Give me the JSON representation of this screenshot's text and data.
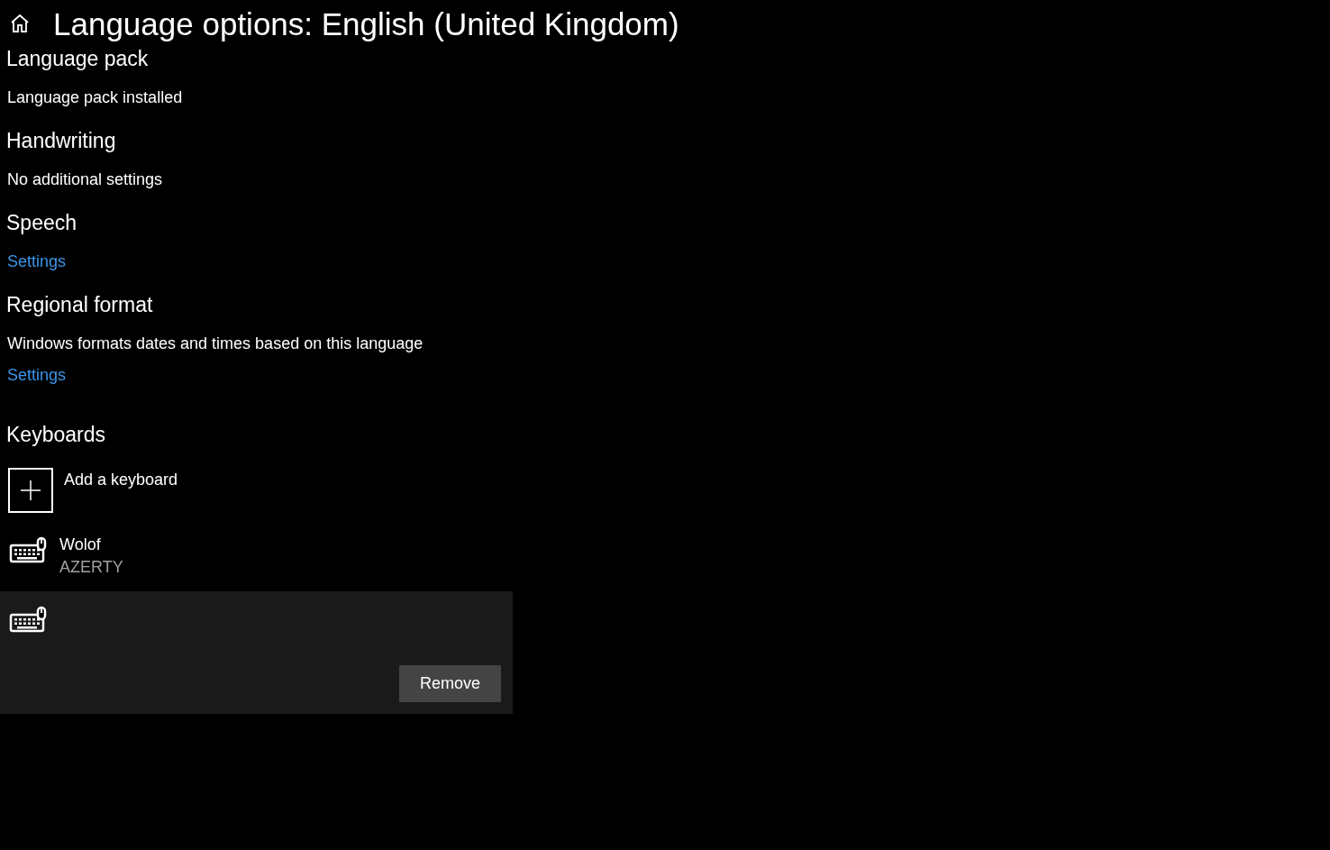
{
  "window": {
    "title": "Language options: English (United Kingdom)"
  },
  "sections": [
    {
      "heading": "Language pack",
      "items": [
        {
          "kind": "text",
          "text": "Language pack installed"
        }
      ]
    },
    {
      "heading": "Handwriting",
      "items": [
        {
          "kind": "text",
          "text": "No additional settings"
        }
      ]
    },
    {
      "heading": "Speech",
      "items": [
        {
          "kind": "link",
          "text": "Settings"
        }
      ]
    },
    {
      "heading": "Regional format",
      "items": [
        {
          "kind": "text",
          "text": "Windows formats dates and times based on this language"
        },
        {
          "kind": "link",
          "text": "Settings"
        }
      ]
    }
  ],
  "keyboards": {
    "heading": "Keyboards",
    "add_label": "Add a keyboard",
    "remove_label": "Remove",
    "items": [
      {
        "name": "Wolof",
        "layout": "AZERTY",
        "selected": false
      },
      {
        "selected": true
      }
    ]
  }
}
